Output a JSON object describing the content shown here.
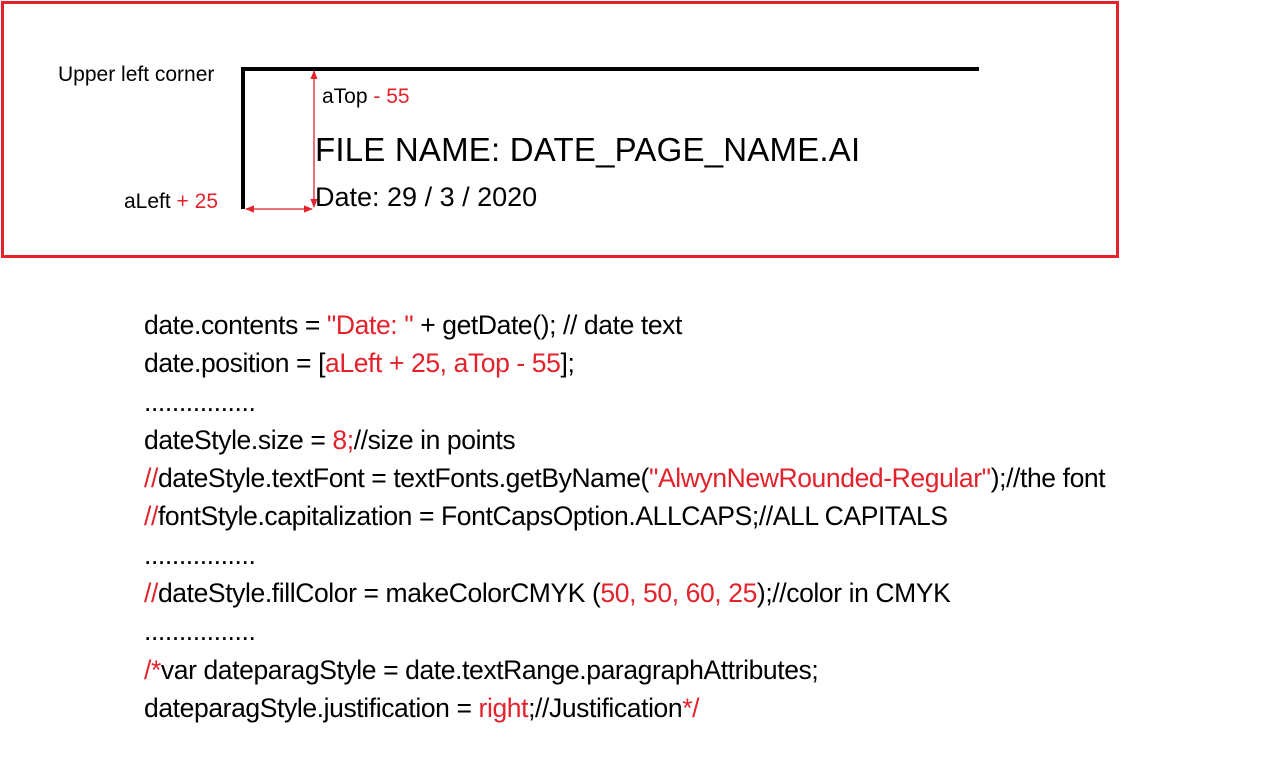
{
  "colors": {
    "accent_red": "#e3222c",
    "text": "#000000"
  },
  "diagram": {
    "corner_label": "Upper left corner",
    "atop": {
      "name": "aTop",
      "offset": " - 55"
    },
    "aleft": {
      "name": "aLeft",
      "offset": " + 25"
    },
    "filename_text": "FILE NAME: DATE_PAGE_NAME.AI",
    "date_text": "Date: 29 / 3 / 2020"
  },
  "code_lines": [
    [
      {
        "t": "date.contents =  ",
        "c": "black"
      },
      {
        "t": "\"Date: \"",
        "c": "red"
      },
      {
        "t": " + getDate(); // date text",
        "c": "black"
      }
    ],
    [
      {
        "t": "date.position = [",
        "c": "black"
      },
      {
        "t": "aLeft + 25, aTop - 55",
        "c": "red"
      },
      {
        "t": "];",
        "c": "black"
      }
    ],
    [
      {
        "t": "................",
        "c": "black"
      }
    ],
    [
      {
        "t": "dateStyle.size = ",
        "c": "black"
      },
      {
        "t": "8;",
        "c": "red"
      },
      {
        "t": "//size in points",
        "c": "black"
      }
    ],
    [
      {
        "t": "//",
        "c": "red"
      },
      {
        "t": "dateStyle.textFont = textFonts.getByName(",
        "c": "black"
      },
      {
        "t": "\"AlwynNewRounded-Regular\"",
        "c": "red"
      },
      {
        "t": ");//the font",
        "c": "black"
      }
    ],
    [
      {
        "t": "//",
        "c": "red"
      },
      {
        "t": "fontStyle.capitalization = FontCapsOption.ALLCAPS;//ALL CAPITALS",
        "c": "black"
      }
    ],
    [
      {
        "t": "................",
        "c": "black"
      }
    ],
    [
      {
        "t": "//",
        "c": "red"
      },
      {
        "t": "dateStyle.fillColor = makeColorCMYK (",
        "c": "black"
      },
      {
        "t": "50,  50,  60, 25",
        "c": "red"
      },
      {
        "t": ");//color in CMYK",
        "c": "black"
      }
    ],
    [
      {
        "t": "................",
        "c": "black"
      }
    ],
    [
      {
        "t": "/*",
        "c": "red"
      },
      {
        "t": "var dateparagStyle = date.textRange.paragraphAttributes;",
        "c": "black"
      }
    ],
    [
      {
        "t": "dateparagStyle.justification = ",
        "c": "black"
      },
      {
        "t": "right",
        "c": "red"
      },
      {
        "t": ";//Justification",
        "c": "black"
      },
      {
        "t": "*/",
        "c": "red"
      }
    ]
  ]
}
